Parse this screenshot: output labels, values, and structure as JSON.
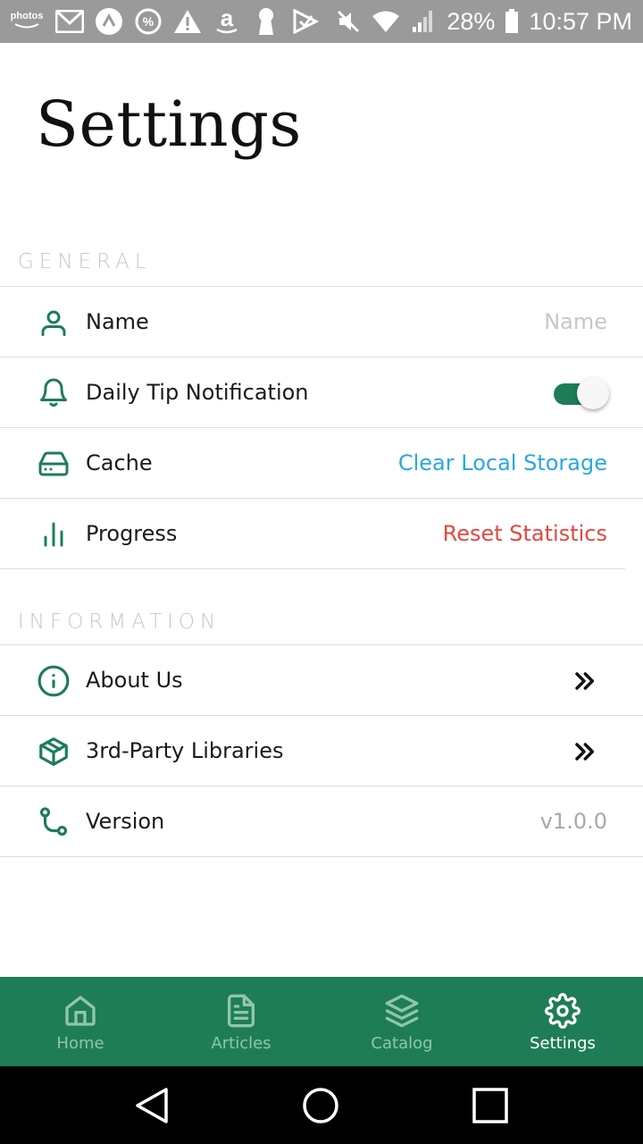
{
  "status_bar": {
    "left_icons": [
      "amazon-photos-icon",
      "gmail-icon",
      "app-a-icon",
      "percent-icon",
      "warning-icon",
      "amazon-icon",
      "keyhole-icon",
      "delivery-icon"
    ],
    "photos_label": "photos",
    "battery": "28%",
    "time": "10:57 PM"
  },
  "page": {
    "title": "Settings"
  },
  "sections": {
    "general": {
      "header": "GENERAL",
      "name": {
        "label": "Name",
        "placeholder": "Name"
      },
      "daily_tip": {
        "label": "Daily Tip Notification",
        "enabled": true
      },
      "cache": {
        "label": "Cache",
        "action": "Clear Local Storage"
      },
      "progress": {
        "label": "Progress",
        "action": "Reset Statistics"
      }
    },
    "information": {
      "header": "INFORMATION",
      "about": {
        "label": "About Us"
      },
      "libraries": {
        "label": "3rd-Party Libraries"
      },
      "version": {
        "label": "Version",
        "value": "v1.0.0"
      }
    }
  },
  "bottom_nav": {
    "items": [
      {
        "label": "Home",
        "icon": "home-icon",
        "active": false
      },
      {
        "label": "Articles",
        "icon": "document-icon",
        "active": false
      },
      {
        "label": "Catalog",
        "icon": "layers-icon",
        "active": false
      },
      {
        "label": "Settings",
        "icon": "gear-icon",
        "active": true
      }
    ]
  },
  "colors": {
    "accent": "#1e7d56",
    "link": "#2aa8e0",
    "danger": "#e5473f",
    "statusbar": "#9a9a9a"
  }
}
